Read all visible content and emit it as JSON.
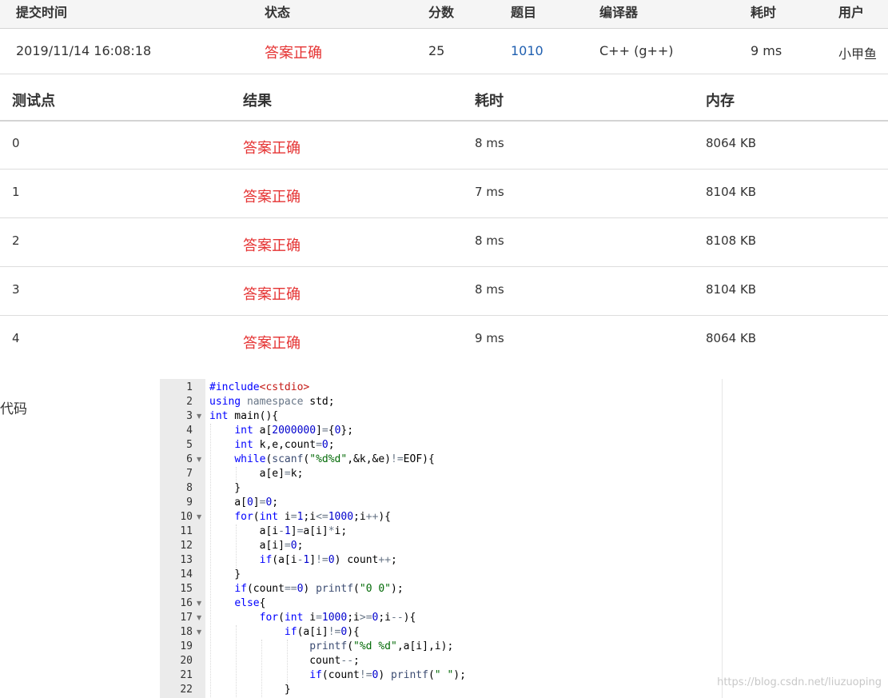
{
  "submission": {
    "headers": {
      "time": "提交时间",
      "status": "状态",
      "score": "分数",
      "problem": "题目",
      "compiler": "编译器",
      "elapsed": "耗时",
      "user": "用户"
    },
    "row": {
      "time": "2019/11/14 16:08:18",
      "status": "答案正确",
      "score": "25",
      "problem": "1010",
      "compiler": "C++ (g++)",
      "elapsed": "9 ms",
      "user": "小甲鱼"
    }
  },
  "cases": {
    "headers": {
      "case": "测试点",
      "result": "结果",
      "time": "耗时",
      "memory": "内存"
    },
    "rows": [
      {
        "case": "0",
        "result": "答案正确",
        "time": "8 ms",
        "memory": "8064 KB"
      },
      {
        "case": "1",
        "result": "答案正确",
        "time": "7 ms",
        "memory": "8104 KB"
      },
      {
        "case": "2",
        "result": "答案正确",
        "time": "8 ms",
        "memory": "8108 KB"
      },
      {
        "case": "3",
        "result": "答案正确",
        "time": "8 ms",
        "memory": "8104 KB"
      },
      {
        "case": "4",
        "result": "答案正确",
        "time": "9 ms",
        "memory": "8064 KB"
      }
    ]
  },
  "code": {
    "label": "代码",
    "line_numbers": [
      "1",
      "2",
      "3",
      "4",
      "5",
      "6",
      "7",
      "8",
      "9",
      "10",
      "11",
      "12",
      "13",
      "14",
      "15",
      "16",
      "17",
      "18",
      "19",
      "20",
      "21",
      "22"
    ],
    "lines": [
      "#include<cstdio>",
      "using namespace std;",
      "int main(){",
      "    int a[2000000]={0};",
      "    int k,e,count=0;",
      "    while(scanf(\"%d%d\",&k,&e)!=EOF){",
      "        a[e]=k;",
      "    }",
      "    a[0]=0;",
      "    for(int i=1;i<=1000;i++){",
      "        a[i-1]=a[i]*i;",
      "        a[i]=0;",
      "        if(a[i-1]!=0) count++;",
      "    }",
      "    if(count==0) printf(\"0 0\");",
      "    else{",
      "        for(int i=1000;i>=0;i--){",
      "            if(a[i]!=0){",
      "                printf(\"%d %d\",a[i],i);",
      "                count--;",
      "                if(count!=0) printf(\" \");",
      "            }"
    ],
    "fold_icon": "fold-arrow-icon"
  },
  "watermark": "https://blog.csdn.net/liuzuoping",
  "colors": {
    "status_red": "#e53333",
    "problem_link": "#1f5fb0",
    "keyword": "#0000ff",
    "string": "#036a07",
    "gutter_bg": "#ebebeb"
  }
}
